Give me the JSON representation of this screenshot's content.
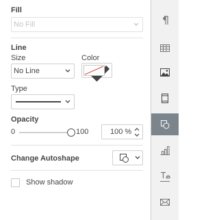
{
  "fill": {
    "title": "Fill",
    "value": "No Fill"
  },
  "line": {
    "title": "Line",
    "size_label": "Size",
    "size_value": "No Line",
    "color_label": "Color",
    "type_label": "Type"
  },
  "opacity": {
    "title": "Opacity",
    "min": "0",
    "max": "100",
    "value": "100 %",
    "level": 100
  },
  "autoshape": {
    "title": "Change Autoshape"
  },
  "shadow": {
    "label": "Show shadow",
    "checked": false
  },
  "rail": {
    "items": [
      {
        "icon": "paragraph-icon"
      },
      {
        "icon": "table-icon"
      },
      {
        "icon": "image-icon"
      },
      {
        "icon": "header-footer-icon"
      },
      {
        "icon": "shape-icon",
        "active": true
      },
      {
        "icon": "chart-icon"
      },
      {
        "icon": "text-art-icon"
      },
      {
        "icon": "mail-merge-icon"
      }
    ]
  },
  "colors": {
    "active_rail": "#7d858c",
    "swatch_slash": "#d9453a"
  }
}
